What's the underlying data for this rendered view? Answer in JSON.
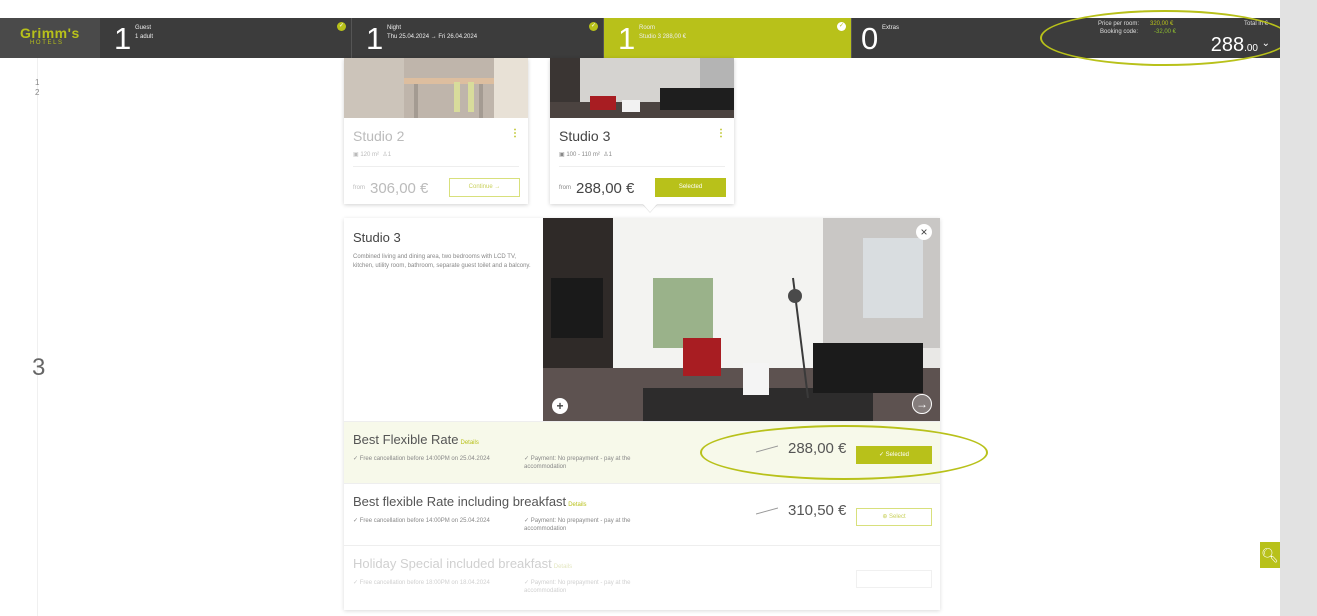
{
  "brand": {
    "name": "Grimm's",
    "sub": "HOTELS"
  },
  "steps": [
    {
      "num": "1",
      "title": "Guest",
      "detail": "1 adult"
    },
    {
      "num": "1",
      "title": "Night",
      "detail": "Thu 25.04.2024 → Fri 26.04.2024"
    },
    {
      "num": "1",
      "title": "Room",
      "detail": "Studio 3 288,00 €"
    },
    {
      "num": "0",
      "title": "Extras",
      "detail": ""
    }
  ],
  "summary": {
    "price_per_room_label": "Price per room:",
    "price_per_room_value": "320,00 €",
    "booking_code_label": "Booking code:",
    "booking_code_value": "-32,00 €",
    "total_label": "Total in €",
    "total_int": "288",
    "total_dec": ".00"
  },
  "rail": {
    "n1": "1",
    "n2": "2",
    "n3": "3"
  },
  "rooms": [
    {
      "name": "Studio 2",
      "area": "120 m²",
      "guests": "1",
      "from": "from",
      "price": "306,00 €",
      "button": "Continue →"
    },
    {
      "name": "Studio 3",
      "area": "100 - 110 m²",
      "guests": "1",
      "from": "from",
      "price": "288,00 €",
      "button": "Selected"
    }
  ],
  "detail": {
    "title": "Studio 3",
    "description": "Combined living and dining area, two bedrooms with LCD TV, kitchen, utility room, bathroom, separate guest toilet and a balcony."
  },
  "rates": [
    {
      "name": "Best Flexible Rate",
      "details": "Details",
      "cancel": "✓ Free cancellation before 14:00PM on 25.04.2024",
      "payment": "✓ Payment: No prepayment - pay at the accommodation",
      "price": "288,00 €",
      "button": "✓ Selected"
    },
    {
      "name": "Best flexible Rate including breakfast",
      "details": "Details",
      "cancel": "✓ Free cancellation before 14:00PM on 25.04.2024",
      "payment": "✓ Payment: No prepayment - pay at the accommodation",
      "price": "310,50 €",
      "button": "⊕ Select"
    },
    {
      "name": "Holiday Special included breakfast",
      "details": "Details",
      "cancel": "✓ Free cancellation before 18:00PM on 18.04.2024",
      "payment": "✓ Payment: No prepayment - pay at the accommodation",
      "price": "",
      "button": ""
    }
  ],
  "colors": {
    "accent": "#b8c11a",
    "header": "#3c3c3c"
  },
  "icons": {
    "check": "check-icon",
    "zoom": "zoom-in-icon",
    "close": "close-icon",
    "plus": "plus-icon",
    "next": "arrow-right-icon"
  }
}
